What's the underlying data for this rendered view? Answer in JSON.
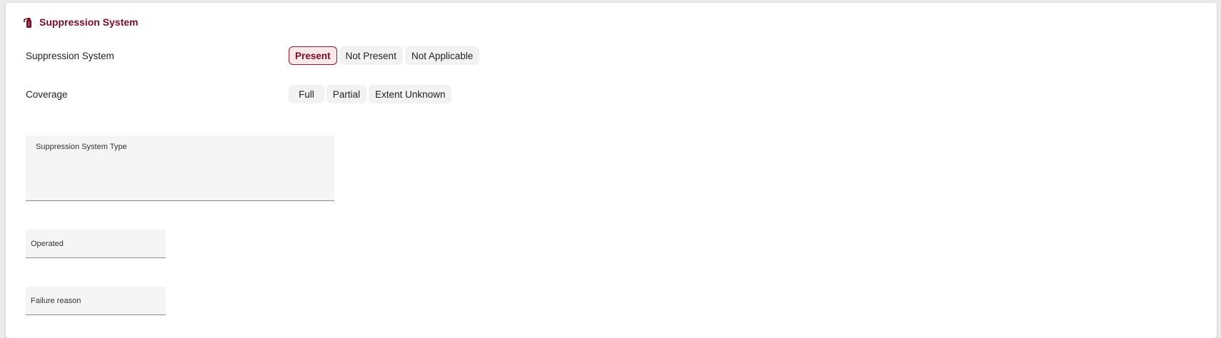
{
  "section": {
    "title": "Suppression System",
    "icon": "fire-suppression-icon",
    "accent_color": "#7a0b24"
  },
  "suppression_system": {
    "label": "Suppression System",
    "options": [
      "Present",
      "Not Present",
      "Not Applicable"
    ],
    "selected": "Present"
  },
  "coverage": {
    "label": "Coverage",
    "options": [
      "Full",
      "Partial",
      "Extent Unknown"
    ],
    "selected": null
  },
  "fields": {
    "system_type": {
      "label": "Suppression System Type",
      "value": ""
    },
    "operated": {
      "label": "Operated",
      "value": ""
    },
    "failure_reason": {
      "label": "Failure reason",
      "value": ""
    }
  }
}
